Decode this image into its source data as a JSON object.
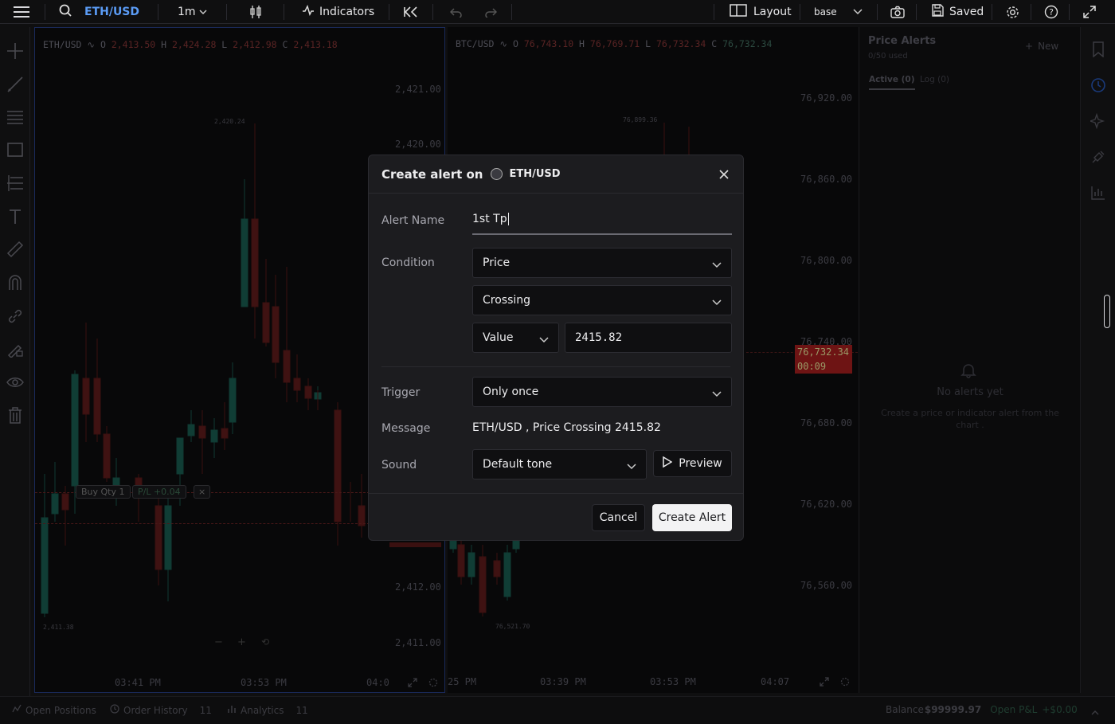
{
  "topbar": {
    "symbol": "ETH/USD",
    "interval": "1m",
    "indicators_label": "Indicators",
    "layout_label": "Layout",
    "base_label": "base",
    "saved_label": "Saved"
  },
  "left_chart": {
    "ohlc_symbol": "ETH/USD",
    "o": "2,413.50",
    "h": "2,424.28",
    "l": "2,412.98",
    "c": "2,413.18",
    "prices": [
      "2,421.00",
      "2,420.00",
      "2,412.00",
      "2,411.00"
    ],
    "times": [
      "03:41 PM",
      "03:53 PM",
      "04:0"
    ],
    "high_marker": "2,420.24",
    "low_marker": "2,411.38",
    "position_tag": "Buy Qty 1",
    "pnl_tag": "P/L +0.04",
    "close_tag": "×"
  },
  "right_chart": {
    "ohlc_symbol": "BTC/USD",
    "o": "76,743.10",
    "h": "76,769.71",
    "l": "76,732.34",
    "c": "76,732.34",
    "prices": [
      "76,920.00",
      "76,860.00",
      "76,800.00",
      "76,740.00",
      "76,680.00",
      "76,620.00",
      "76,560.00"
    ],
    "times": [
      "25 PM",
      "03:39 PM",
      "03:53 PM",
      "04:07"
    ],
    "high_marker": "76,899.36",
    "low_marker": "76,521.70",
    "last_price": "76,732.34",
    "countdown": "00:09"
  },
  "alerts_panel": {
    "title": "Price Alerts",
    "used": "0/50 used",
    "new_label": "New",
    "tab_active": "Active (0)",
    "tab_log": "Log (0)",
    "empty_title": "No alerts yet",
    "empty_desc": "Create a price or indicator alert from the chart ."
  },
  "bottombar": {
    "open_positions": "Open Positions",
    "order_history": "Order History",
    "order_history_count": "11",
    "analytics": "Analytics",
    "analytics_count": "11",
    "balance_label": "Balance",
    "balance_value": "$99999.97",
    "open_pnl_label": "Open P&L",
    "open_pnl_value": "+$0.00"
  },
  "modal": {
    "title": "Create alert on",
    "symbol": "ETH/USD",
    "name_label": "Alert Name",
    "name_value": "1st Tp",
    "condition_label": "Condition",
    "condition_source": "Price",
    "condition_op": "Crossing",
    "value_type": "Value",
    "value": "2415.82",
    "trigger_label": "Trigger",
    "trigger_value": "Only once",
    "message_label": "Message",
    "message_value": "ETH/USD , Price Crossing 2415.82",
    "sound_label": "Sound",
    "sound_value": "Default tone",
    "preview_label": "Preview",
    "cancel_label": "Cancel",
    "create_label": "Create Alert"
  },
  "colors": {
    "accent": "#5b9cf6",
    "up": "#1f6b5c",
    "down": "#7a1c1c",
    "modal_bg": "#1c1c1f"
  }
}
